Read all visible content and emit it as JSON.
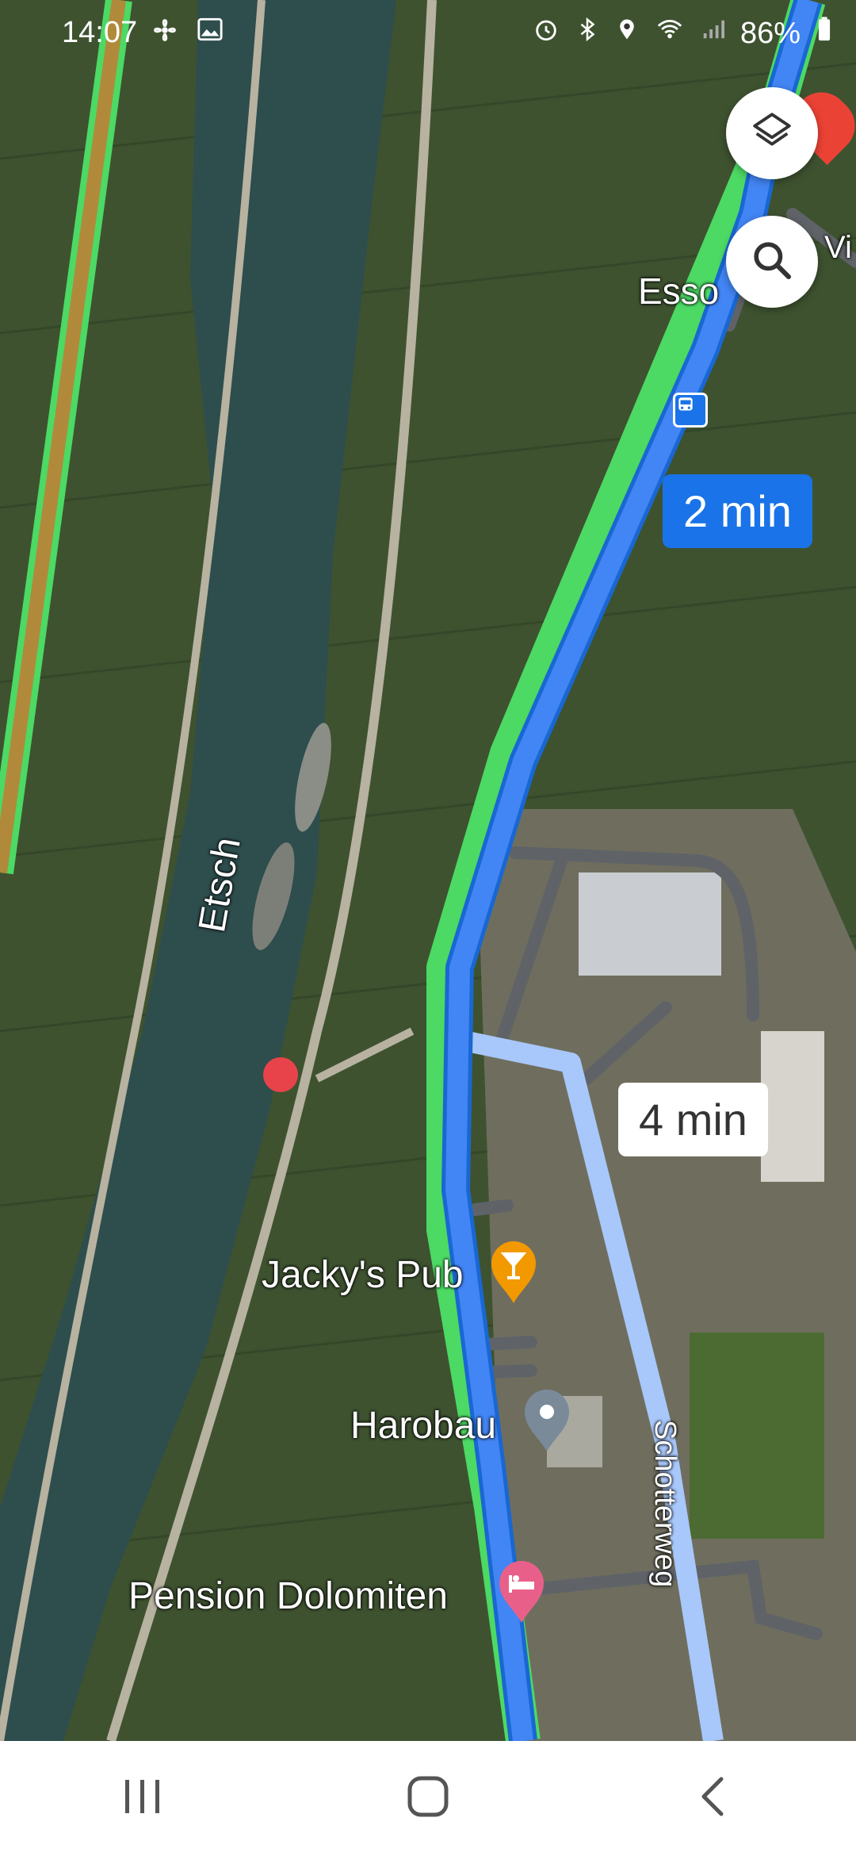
{
  "status_bar": {
    "time": "14:07",
    "battery": "86%",
    "left_icons": [
      "fan-icon",
      "image-icon"
    ],
    "right_icons": [
      "alarm-icon",
      "bluetooth-icon",
      "location-icon",
      "wifi-icon",
      "signal-icon",
      "battery-icon"
    ]
  },
  "map": {
    "labels": {
      "river": "Etsch",
      "esso": "Esso",
      "street_right": "Vi",
      "street_schotterweg": "Schotterweg",
      "place_jackys": "Jacky's Pub",
      "place_harobau": "Harobau",
      "place_pension": "Pension Dolomiten"
    },
    "route_times": {
      "primary": "2 min",
      "alternative": "4 min"
    },
    "colors": {
      "primary_route": "#4285f4",
      "alternative_route": "#a8c7fa",
      "river": "#2f4f50",
      "traffic_green": "#4cd964"
    }
  },
  "controls": {
    "layers_icon": "layers-icon",
    "search_icon": "search-icon"
  },
  "nav_bar": {
    "recent_icon": "recent-apps-icon",
    "home_icon": "home-icon",
    "back_icon": "back-icon"
  }
}
